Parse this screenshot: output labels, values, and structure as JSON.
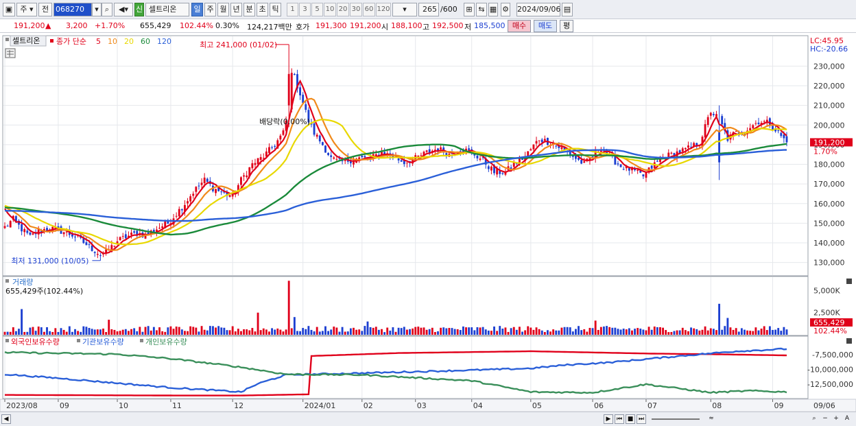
{
  "toolbar": {
    "market_type": "주",
    "prev_label": "전",
    "code": "068270",
    "stock_badge": "신",
    "stock_name": "셀트리온",
    "period_tabs": [
      "일",
      "주",
      "월",
      "년",
      "분",
      "초",
      "틱"
    ],
    "active_period": "일",
    "number_buttons": [
      "1",
      "3",
      "5",
      "10",
      "20",
      "30",
      "60",
      "120"
    ],
    "count": "265",
    "count_total": "/600",
    "date": "2024/09/06"
  },
  "quote": {
    "price": "191,200",
    "change": "3,200",
    "change_pct": "+1.70%",
    "volume": "655,429",
    "volume_ratio": "102.44%",
    "turnover_pct": "0.30%",
    "amount": "124,217백만",
    "ask_bid_label": "호가",
    "ask": "191,300",
    "bid": "191,200",
    "open_label": "시",
    "open": "188,100",
    "high_label": "고",
    "high": "192,500",
    "low_label": "저",
    "low": "185,500",
    "buy_label": "매수",
    "sell_label": "매도",
    "eval_label": "평"
  },
  "legend": {
    "stock": "셀트리온",
    "ma_prefix": "종가 단순",
    "ma_periods": [
      "5",
      "10",
      "20",
      "60",
      "120"
    ],
    "ma_colors": [
      "#e0001a",
      "#f08a1a",
      "#e8d800",
      "#1a8a3a",
      "#2a5fd8"
    ],
    "lc": "LC:45.95",
    "hc": "HC:-20.66",
    "current_price_tag": "191,200",
    "current_pct_tag": "1.70%"
  },
  "annotations": {
    "high": "최고 241,000 (01/02)",
    "low": "최저 131,000 (10/05)",
    "dividend": "배당락(0.00%)"
  },
  "volume_panel": {
    "title": "거래량",
    "value_text": "655,429주(102.44%)",
    "axis_labels": [
      "5,000K",
      "2,500K"
    ],
    "current_tag": "655,429",
    "current_pct": "102.44%"
  },
  "holdings_panel": {
    "series_names": [
      "외국인보유수량",
      "기관보유수량",
      "개인보유수량"
    ],
    "series_colors": [
      "#e0001a",
      "#2a5fd8",
      "#3a8f5a"
    ],
    "axis_labels": [
      "-7,500,000",
      "-10,000,000",
      "-12,500,000"
    ]
  },
  "x_axis": {
    "labels": [
      "2023/08",
      "09",
      "10",
      "11",
      "12",
      "2024/01",
      "02",
      "03",
      "04",
      "05",
      "06",
      "07",
      "08",
      "09"
    ],
    "right_label": "09/06"
  },
  "chart_data": {
    "type": "candlestick",
    "price_axis": {
      "ticks": [
        130000,
        140000,
        150000,
        160000,
        170000,
        180000,
        190000,
        200000,
        210000,
        220000,
        230000
      ],
      "range": [
        125000,
        242000
      ]
    },
    "volume_axis": {
      "ticks_k": [
        2500,
        5000
      ],
      "range_k": [
        0,
        6200
      ]
    },
    "holdings_axis": {
      "ticks": [
        -7500000,
        -10000000,
        -12500000
      ],
      "range": [
        -14800000,
        -5500000
      ]
    },
    "months": [
      "2023/08",
      "09",
      "10",
      "11",
      "12",
      "2024/01",
      "02",
      "03",
      "04",
      "05",
      "06",
      "07",
      "08",
      "09"
    ],
    "month_start_index": [
      0,
      19,
      40,
      59,
      81,
      106,
      127,
      146,
      166,
      187,
      209,
      228,
      251,
      273
    ],
    "n_days": 279,
    "price_anchors": [
      [
        0,
        148000
      ],
      [
        3,
        152000
      ],
      [
        6,
        147000
      ],
      [
        9,
        143000
      ],
      [
        12,
        146000
      ],
      [
        16,
        147500
      ],
      [
        20,
        146000
      ],
      [
        25,
        143500
      ],
      [
        30,
        138000
      ],
      [
        34,
        134000
      ],
      [
        36,
        135000
      ],
      [
        40,
        141000
      ],
      [
        43,
        143000
      ],
      [
        47,
        145000
      ],
      [
        50,
        144000
      ],
      [
        55,
        148000
      ],
      [
        58,
        150000
      ],
      [
        61,
        155000
      ],
      [
        64,
        160000
      ],
      [
        67,
        166000
      ],
      [
        71,
        172000
      ],
      [
        74,
        168000
      ],
      [
        78,
        165000
      ],
      [
        81,
        164000
      ],
      [
        84,
        172000
      ],
      [
        88,
        180000
      ],
      [
        92,
        184000
      ],
      [
        96,
        190000
      ],
      [
        99,
        196000
      ],
      [
        101,
        208000
      ],
      [
        102,
        228000
      ],
      [
        103,
        224000
      ],
      [
        105,
        216000
      ],
      [
        108,
        202000
      ],
      [
        110,
        196000
      ],
      [
        113,
        190000
      ],
      [
        116,
        183000
      ],
      [
        119,
        181000
      ],
      [
        122,
        182000
      ],
      [
        126,
        183000
      ],
      [
        130,
        183000
      ],
      [
        134,
        186000
      ],
      [
        138,
        184000
      ],
      [
        142,
        181000
      ],
      [
        146,
        183000
      ],
      [
        150,
        186000
      ],
      [
        154,
        188000
      ],
      [
        158,
        185000
      ],
      [
        162,
        188000
      ],
      [
        166,
        186000
      ],
      [
        170,
        182000
      ],
      [
        174,
        176000
      ],
      [
        178,
        176000
      ],
      [
        181,
        180000
      ],
      [
        185,
        184000
      ],
      [
        190,
        193000
      ],
      [
        194,
        191000
      ],
      [
        198,
        188000
      ],
      [
        202,
        184000
      ],
      [
        206,
        180000
      ],
      [
        209,
        184000
      ],
      [
        212,
        189000
      ],
      [
        215,
        184000
      ],
      [
        219,
        179000
      ],
      [
        223,
        177000
      ],
      [
        227,
        174000
      ],
      [
        231,
        180000
      ],
      [
        235,
        184000
      ],
      [
        239,
        186000
      ],
      [
        243,
        188000
      ],
      [
        247,
        191000
      ],
      [
        251,
        207000
      ],
      [
        254,
        203000
      ],
      [
        257,
        193000
      ],
      [
        260,
        196000
      ],
      [
        264,
        198000
      ],
      [
        268,
        202000
      ],
      [
        272,
        201000
      ],
      [
        275,
        196000
      ],
      [
        278,
        191200
      ]
    ],
    "extremes": {
      "high": 241000,
      "high_date": "01/02",
      "low": 131000,
      "low_date": "10/05"
    },
    "volume_spikes_k": [
      [
        6,
        2900
      ],
      [
        37,
        1700
      ],
      [
        90,
        2500
      ],
      [
        101,
        6100
      ],
      [
        103,
        2000
      ],
      [
        129,
        1500
      ],
      [
        210,
        1600
      ],
      [
        254,
        3500
      ],
      [
        257,
        1900
      ]
    ],
    "holdings": {
      "foreign": [
        [
          0,
          -14300000
        ],
        [
          60,
          -14400000
        ],
        [
          84,
          -14400000
        ],
        [
          108,
          -14200000
        ],
        [
          109,
          -7700000
        ],
        [
          140,
          -7200000
        ],
        [
          187,
          -6900000
        ],
        [
          230,
          -7300000
        ],
        [
          251,
          -7400000
        ],
        [
          278,
          -7600000
        ]
      ],
      "institution": [
        [
          0,
          -10800000
        ],
        [
          20,
          -11500000
        ],
        [
          40,
          -12300000
        ],
        [
          60,
          -13100000
        ],
        [
          84,
          -13800000
        ],
        [
          90,
          -12400000
        ],
        [
          100,
          -10900000
        ],
        [
          127,
          -10600000
        ],
        [
          166,
          -10100000
        ],
        [
          187,
          -9800000
        ],
        [
          200,
          -9200000
        ],
        [
          215,
          -8800000
        ],
        [
          240,
          -7700000
        ],
        [
          260,
          -6900000
        ],
        [
          278,
          -6500000
        ]
      ],
      "individual": [
        [
          0,
          -7100000
        ],
        [
          40,
          -7400000
        ],
        [
          60,
          -8200000
        ],
        [
          84,
          -9600000
        ],
        [
          100,
          -10800000
        ],
        [
          127,
          -10900000
        ],
        [
          166,
          -11900000
        ],
        [
          187,
          -13800000
        ],
        [
          209,
          -13900000
        ],
        [
          228,
          -12500000
        ],
        [
          251,
          -13900000
        ],
        [
          265,
          -13600000
        ],
        [
          278,
          -13800000
        ]
      ]
    }
  }
}
